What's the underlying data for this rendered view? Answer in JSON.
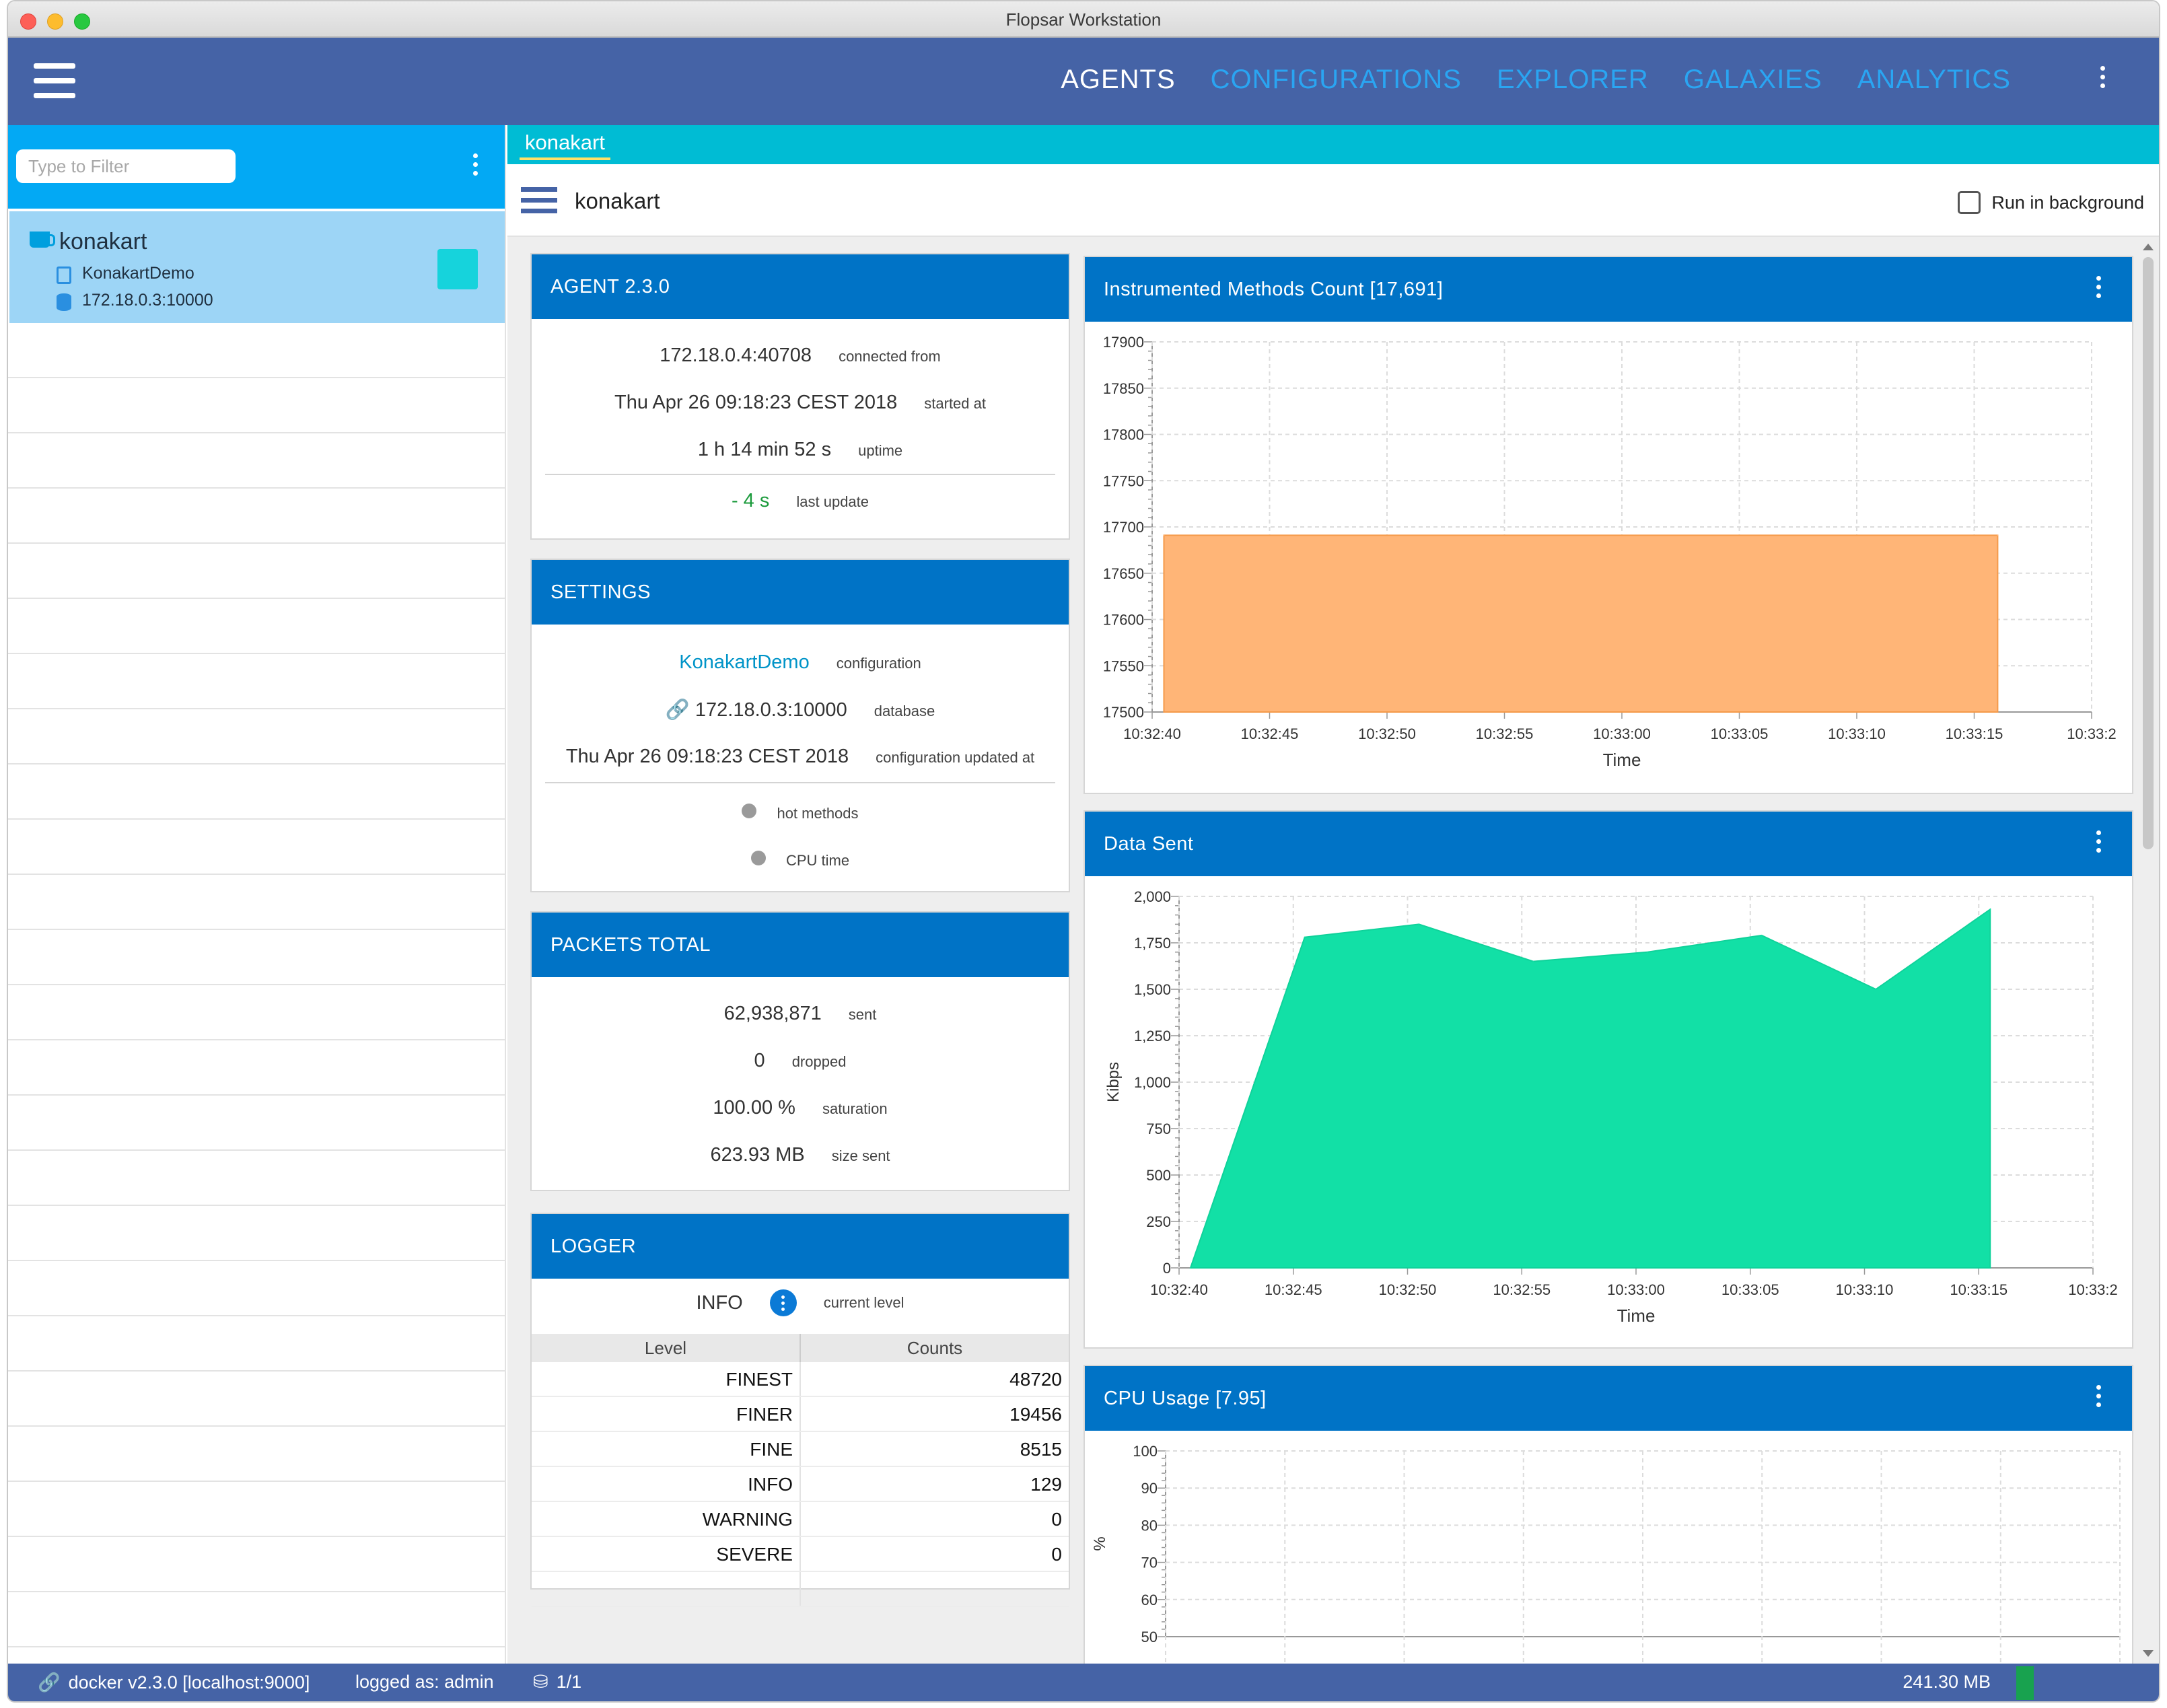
{
  "window": {
    "title": "Flopsar Workstation"
  },
  "nav": {
    "tabs": [
      "AGENTS",
      "CONFIGURATIONS",
      "EXPLORER",
      "GALAXIES",
      "ANALYTICS"
    ],
    "active": "AGENTS"
  },
  "sidebar": {
    "filter_placeholder": "Type to Filter",
    "agent": {
      "name": "konakart",
      "config": "KonakartDemo",
      "database": "172.18.0.3:10000"
    }
  },
  "main": {
    "tab": "konakart",
    "title": "konakart",
    "run_in_background": "Run in background"
  },
  "agent_card": {
    "title": "AGENT 2.3.0",
    "rows": [
      {
        "value": "172.18.0.4:40708",
        "key": "connected from"
      },
      {
        "value": "Thu Apr 26 09:18:23 CEST 2018",
        "key": "started at"
      },
      {
        "value": "1 h 14 min 52 s",
        "key": "uptime"
      }
    ],
    "last_update": {
      "value": "- 4 s",
      "key": "last update"
    }
  },
  "settings_card": {
    "title": "SETTINGS",
    "configuration": {
      "value": "KonakartDemo",
      "key": "configuration"
    },
    "database": {
      "value": "172.18.0.3:10000",
      "key": "database"
    },
    "updated": {
      "value": "Thu Apr 26 09:18:23 CEST 2018",
      "key": "configuration updated at"
    },
    "hot_methods": "hot methods",
    "cpu_time": "CPU time"
  },
  "packets_card": {
    "title": "PACKETS TOTAL",
    "rows": [
      {
        "value": "62,938,871",
        "key": "sent"
      },
      {
        "value": "0",
        "key": "dropped"
      },
      {
        "value": "100.00 %",
        "key": "saturation"
      },
      {
        "value": "623.93 MB",
        "key": "size sent"
      }
    ]
  },
  "logger_card": {
    "title": "LOGGER",
    "level": {
      "value": "INFO",
      "key": "current level"
    },
    "columns": [
      "Level",
      "Counts"
    ],
    "rows": [
      {
        "level": "FINEST",
        "count": "48720"
      },
      {
        "level": "FINER",
        "count": "19456"
      },
      {
        "level": "FINE",
        "count": "8515"
      },
      {
        "level": "INFO",
        "count": "129"
      },
      {
        "level": "WARNING",
        "count": "0"
      },
      {
        "level": "SEVERE",
        "count": "0"
      }
    ]
  },
  "chart_data": [
    {
      "type": "area",
      "title": "Instrumented Methods Count [17,691]",
      "xlabel": "Time",
      "ylabel": "",
      "ylim": [
        17500,
        17900
      ],
      "yticks": [
        "17900",
        "17850",
        "17800",
        "17750",
        "17700",
        "17650",
        "17600",
        "17550",
        "17500"
      ],
      "xticks": [
        "10:32:40",
        "10:32:45",
        "10:32:50",
        "10:32:55",
        "10:33:00",
        "10:33:05",
        "10:33:10",
        "10:33:15",
        "10:33:2"
      ],
      "x": [
        "10:32:40.5",
        "10:33:16"
      ],
      "values": [
        17691,
        17691
      ],
      "color": "#ffb577"
    },
    {
      "type": "area",
      "title": "Data Sent",
      "xlabel": "Time",
      "ylabel": "Kibps",
      "ylim": [
        0,
        2000
      ],
      "yticks": [
        "2,000",
        "1,750",
        "1,500",
        "1,250",
        "1,000",
        "750",
        "500",
        "250",
        "0"
      ],
      "xticks": [
        "10:32:40",
        "10:32:45",
        "10:32:50",
        "10:32:55",
        "10:33:00",
        "10:33:05",
        "10:33:10",
        "10:33:15",
        "10:33:2"
      ],
      "x": [
        "10:32:40.5",
        "10:32:45.5",
        "10:32:50.5",
        "10:32:55.5",
        "10:33:00.5",
        "10:33:05.5",
        "10:33:10.5",
        "10:33:15.5"
      ],
      "values": [
        0,
        1780,
        1850,
        1650,
        1700,
        1790,
        1500,
        1930
      ],
      "color": "#12e0a6"
    },
    {
      "type": "line",
      "title": "CPU Usage [7.95]",
      "xlabel": "",
      "ylabel": "%",
      "ylim": [
        50,
        100
      ],
      "yticks": [
        "100",
        "90",
        "80",
        "70",
        "60",
        "50"
      ]
    }
  ],
  "status": {
    "server": "docker v2.3.0 [localhost:9000]",
    "user": "logged as: admin",
    "db": "1/1",
    "memory": "241.30 MB"
  }
}
